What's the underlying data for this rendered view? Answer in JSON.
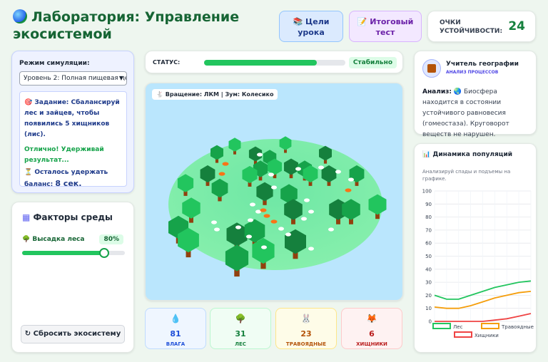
{
  "header": {
    "title": "Лаборатория: Управление экосистемой",
    "goals_label": "Цели урока",
    "test_label": "Итоговый тест",
    "score_label": "ОЧКИ УСТОЙЧИВОСТИ:",
    "score_value": "24"
  },
  "mode": {
    "label": "Режим симуляции:",
    "selected": "Уровень 2: Полная пищевая цепь",
    "task": "Задание: Сбалансируй лес и зайцев, чтобы появились 5 хищников (лис).",
    "success": "Отлично! Удерживай результат...",
    "remaining_prefix": "Осталось удержать баланс:",
    "remaining_value": "8 сек."
  },
  "env": {
    "title": "Факторы среды",
    "factor_label": "Высадка леса",
    "factor_value": "80%",
    "factor_level": 80,
    "reset_label": "Сбросить экосистему"
  },
  "status": {
    "label": "СТАТУС:",
    "level": 80,
    "badge": "Стабильно"
  },
  "scene": {
    "hint": "Вращение: ЛКМ | Зум: Колесико"
  },
  "stats": {
    "water_value": "81",
    "water_label": "ВЛАГА",
    "forest_value": "31",
    "forest_label": "ЛЕС",
    "herb_value": "23",
    "herb_label": "ТРАВОЯДНЫЕ",
    "pred_value": "6",
    "pred_label": "ХИЩНИКИ"
  },
  "teacher": {
    "name": "Учитель географии",
    "role": "АНАЛИЗ ПРОЦЕССОВ",
    "analysis_label": "Анализ:",
    "analysis_text": "Биосфера находится в состоянии устойчивого равновесия (гомеостаза). Круговорот веществ не нарушен."
  },
  "chart_title": "Динамика популяций",
  "chart_subtitle": "Анализируй спады и подъемы на графике.",
  "colors": {
    "forest": "#22c55e",
    "herbivores": "#f59e0b",
    "predators": "#ef4444"
  },
  "chart_data": {
    "type": "line",
    "title": "Динамика популяций",
    "ylim": [
      0,
      100
    ],
    "yticks": [
      0,
      10,
      20,
      30,
      40,
      50,
      60,
      70,
      80,
      90,
      100
    ],
    "x": [
      0,
      1,
      2,
      3,
      4,
      5,
      6,
      7,
      8
    ],
    "grid": true,
    "legend": "bottom",
    "series": [
      {
        "name": "Лес",
        "values": [
          20,
          17,
          17,
          20,
          23,
          26,
          28,
          30,
          31
        ]
      },
      {
        "name": "Травоядные",
        "values": [
          11,
          10,
          10,
          12,
          15,
          18,
          20,
          22,
          23
        ]
      },
      {
        "name": "Хищники",
        "values": [
          0,
          0,
          0,
          0,
          0,
          1,
          2,
          4,
          6
        ]
      }
    ]
  }
}
